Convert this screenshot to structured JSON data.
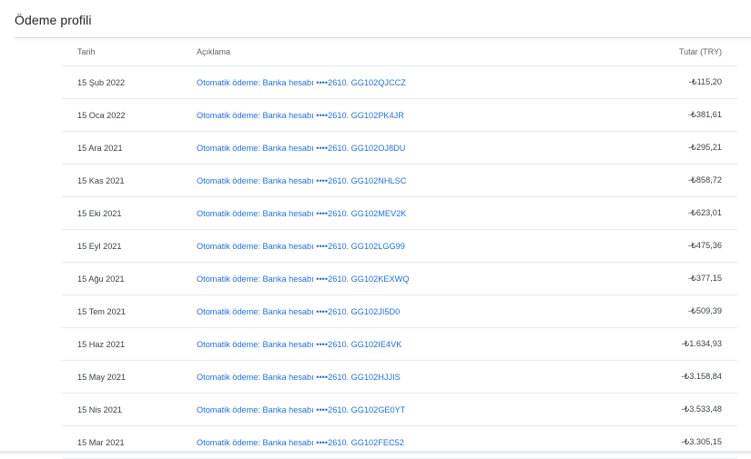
{
  "page": {
    "title": "Ödeme profili"
  },
  "table": {
    "headers": {
      "date": "Tarih",
      "description": "Açıklama",
      "amount": "Tutar (TRY)"
    },
    "rows": [
      {
        "date": "15 Şub 2022",
        "description": "Otomatik ödeme: Banka hesabı ••••2610. GG102QJCCZ",
        "amount": "-₺115,20"
      },
      {
        "date": "15 Oca 2022",
        "description": "Otomatik ödeme: Banka hesabı ••••2610. GG102PK4JR",
        "amount": "-₺381,61"
      },
      {
        "date": "15 Ara 2021",
        "description": "Otomatik ödeme: Banka hesabı ••••2610. GG102OJ8DU",
        "amount": "-₺295,21"
      },
      {
        "date": "15 Kas 2021",
        "description": "Otomatik ödeme: Banka hesabı ••••2610. GG102NHLSC",
        "amount": "-₺858,72"
      },
      {
        "date": "15 Eki 2021",
        "description": "Otomatik ödeme: Banka hesabı ••••2610. GG102MEV2K",
        "amount": "-₺623,01"
      },
      {
        "date": "15 Eyl 2021",
        "description": "Otomatik ödeme: Banka hesabı ••••2610. GG102LGG99",
        "amount": "-₺475,36"
      },
      {
        "date": "15 Ağu 2021",
        "description": "Otomatik ödeme: Banka hesabı ••••2610. GG102KEXWQ",
        "amount": "-₺377,15"
      },
      {
        "date": "15 Tem 2021",
        "description": "Otomatik ödeme: Banka hesabı ••••2610. GG102JI5D0",
        "amount": "-₺509,39"
      },
      {
        "date": "15 Haz 2021",
        "description": "Otomatik ödeme: Banka hesabı ••••2610. GG102IE4VK",
        "amount": "-₺1.634,93"
      },
      {
        "date": "15 May 2021",
        "description": "Otomatik ödeme: Banka hesabı ••••2610. GG102HJJIS",
        "amount": "-₺3.158,84"
      },
      {
        "date": "15 Nis 2021",
        "description": "Otomatik ödeme: Banka hesabı ••••2610. GG102GE0YT",
        "amount": "-₺3.533,48"
      },
      {
        "date": "15 Mar 2021",
        "description": "Otomatik ödeme: Banka hesabı ••••2610. GG102FEC52",
        "amount": "-₺3.305,15"
      }
    ]
  }
}
